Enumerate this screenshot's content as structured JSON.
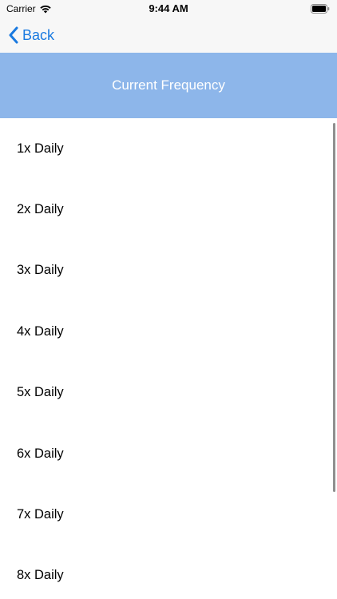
{
  "status_bar": {
    "carrier": "Carrier",
    "time": "9:44 AM"
  },
  "nav": {
    "back_label": "Back",
    "accent_color": "#1a7ae0"
  },
  "header": {
    "title": "Current Frequency",
    "background_color": "#8db6ea"
  },
  "list": {
    "items": [
      {
        "label": "1x Daily"
      },
      {
        "label": "2x Daily"
      },
      {
        "label": "3x Daily"
      },
      {
        "label": "4x Daily"
      },
      {
        "label": "5x Daily"
      },
      {
        "label": "6x Daily"
      },
      {
        "label": "7x Daily"
      },
      {
        "label": "8x Daily"
      }
    ]
  }
}
